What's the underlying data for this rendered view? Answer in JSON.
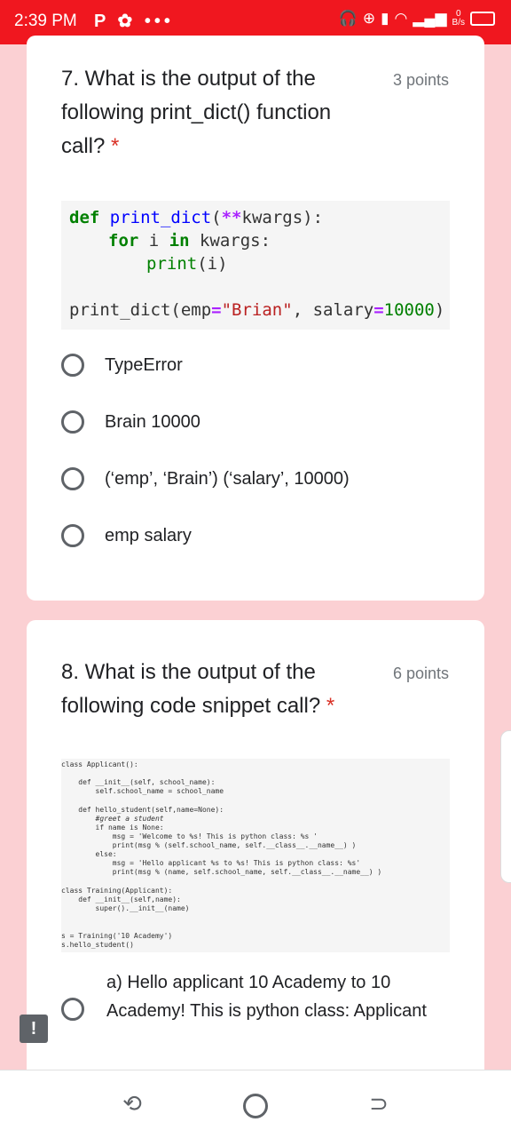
{
  "status": {
    "time": "2:39 PM",
    "left_icons": "P ✿ •••",
    "net_speed_value": "0",
    "net_speed_unit": "B/s"
  },
  "question7": {
    "title": "7. What is the output of the following print_dict() function call?",
    "required_mark": "*",
    "points": "3 points",
    "code": {
      "l1_def": "def ",
      "l1_fn": "print_dict",
      "l1_paren": "(",
      "l1_op": "**",
      "l1_rest": "kwargs):",
      "l2_for": "for",
      "l2_mid": " i ",
      "l2_in": "in",
      "l2_rest": " kwargs:",
      "l3_print": "print",
      "l3_rest": "(i)",
      "l4_call": "print_dict(emp",
      "l4_eq": "=",
      "l4_str": "\"Brian\"",
      "l4_mid": ", salary",
      "l4_eq2": "=",
      "l4_num": "10000",
      "l4_end": ")"
    },
    "options": [
      "TypeError",
      "Brain 10000",
      "(‘emp’, ‘Brain’) (‘salary’, 10000)",
      "emp salary"
    ]
  },
  "question8": {
    "title": "8. What is the output of the following code snippet call?",
    "required_mark": "*",
    "points": "6 points",
    "code_lines": [
      "class Applicant():",
      "    def __init__(self, school_name):",
      "        self.school_name = school_name",
      "",
      "    def hello_student(self,name=None):",
      "        #greet a student",
      "        if name is None:",
      "            msg = 'Welcome to %s! This is python class: %s '",
      "            print(msg % (self.school_name, self.__class__.__name__) )",
      "        else:",
      "            msg = 'Hello applicant %s to %s! This is python class: %s'",
      "            print(msg % (name, self.school_name, self.__class__.__name__) )",
      "",
      "class Training(Applicant):",
      "    def __init__(self,name):",
      "        super().__init__(name)",
      "",
      "s = Training('10 Academy')",
      "s.hello_student()"
    ],
    "option_a": "a) Hello applicant 10 Academy to 10 Academy! This is python class: Applicant"
  }
}
